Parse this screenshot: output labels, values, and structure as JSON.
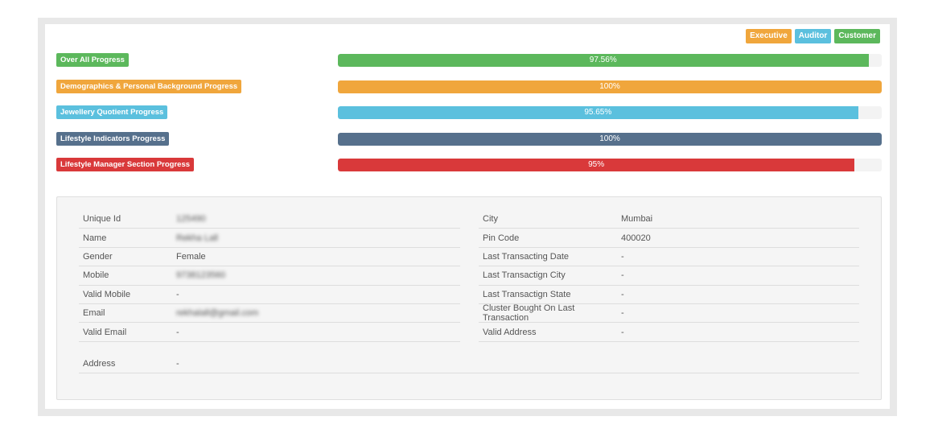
{
  "roles": [
    {
      "label": "Executive",
      "color": "#f0a63c"
    },
    {
      "label": "Auditor",
      "color": "#5bc0de"
    },
    {
      "label": "Customer",
      "color": "#5cb85c"
    }
  ],
  "progress": [
    {
      "label": "Over All Progress",
      "value_text": "97.56%",
      "value": 97.56,
      "color": "#5cb85c"
    },
    {
      "label": "Demographics & Personal Background Progress",
      "value_text": "100%",
      "value": 100,
      "color": "#f0a63c"
    },
    {
      "label": "Jewellery Quotient Progress",
      "value_text": "95.65%",
      "value": 95.65,
      "color": "#5bc0de"
    },
    {
      "label": "Lifestyle Indicators Progress",
      "value_text": "100%",
      "value": 100,
      "color": "#56708c"
    },
    {
      "label": "Lifestyle Manager Section Progress",
      "value_text": "95%",
      "value": 95,
      "color": "#d9393a"
    }
  ],
  "details_left": [
    {
      "key": "Unique Id",
      "value": "125490",
      "blurred": true
    },
    {
      "key": "Name",
      "value": "Rekha Lall",
      "blurred": true
    },
    {
      "key": "Gender",
      "value": "Female",
      "blurred": false
    },
    {
      "key": "Mobile",
      "value": "9738123560",
      "blurred": true
    },
    {
      "key": "Valid Mobile",
      "value": "-",
      "blurred": false
    },
    {
      "key": "Email",
      "value": "rekhalall@gmail.com",
      "blurred": true
    },
    {
      "key": "Valid Email",
      "value": "-",
      "blurred": false
    }
  ],
  "details_right": [
    {
      "key": "City",
      "value": "Mumbai"
    },
    {
      "key": "Pin Code",
      "value": "400020"
    },
    {
      "key": "Last Transacting Date",
      "value": "-"
    },
    {
      "key": "Last Transactign City",
      "value": "-"
    },
    {
      "key": "Last Transactign State",
      "value": "-"
    },
    {
      "key": "Cluster Bought On Last Transaction",
      "value": "-"
    },
    {
      "key": "Valid Address",
      "value": "-"
    }
  ],
  "address": {
    "key": "Address",
    "value": "-"
  }
}
